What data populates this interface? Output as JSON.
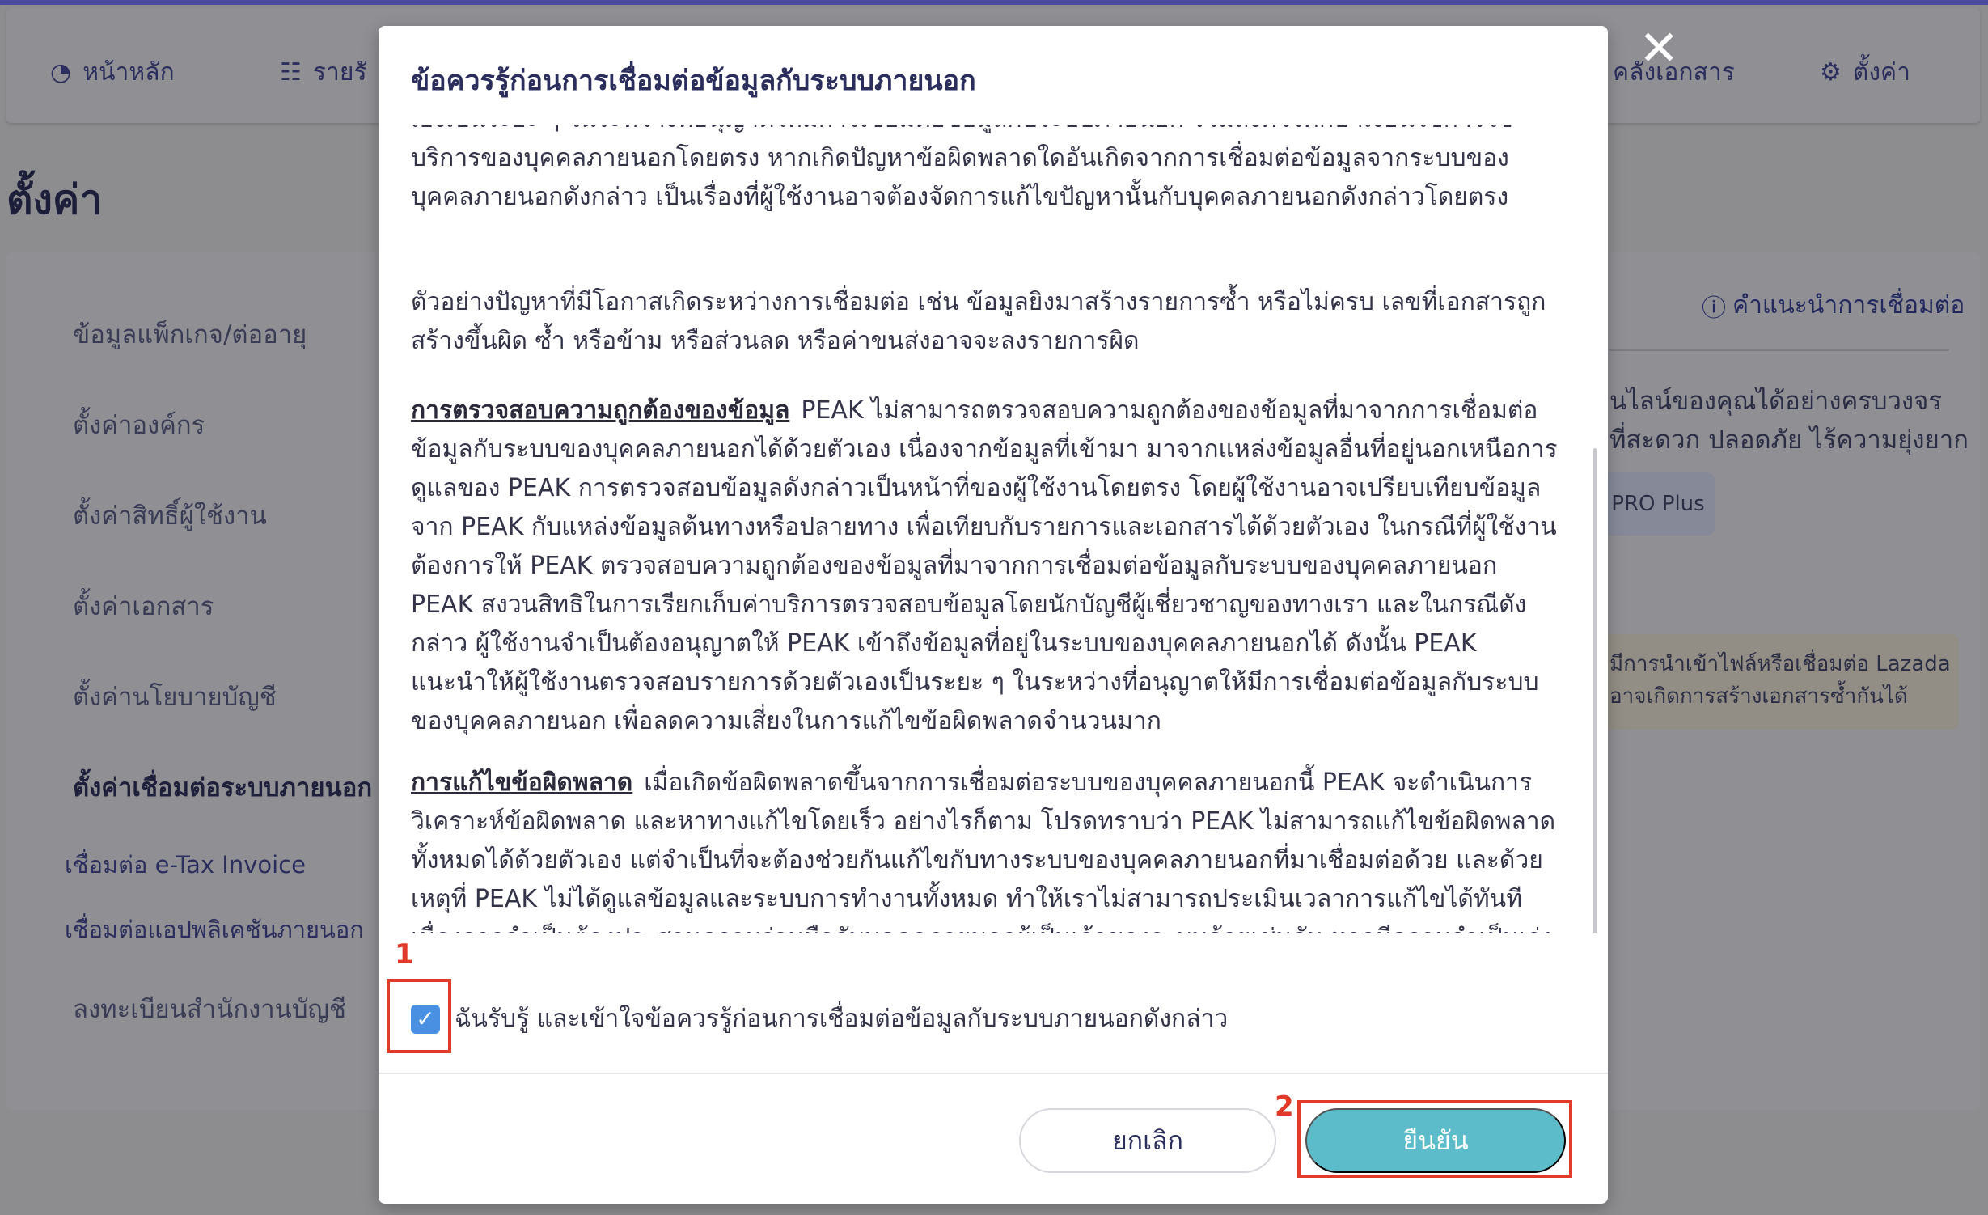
{
  "nav": {
    "home": "หน้าหลัก",
    "income": "รายรั",
    "docs": "คลังเอกสาร",
    "settings": "ตั้งค่า"
  },
  "page": {
    "title": "ตั้งค่า"
  },
  "sidebar": {
    "items": [
      "ข้อมูลแพ็กเกจ/ต่ออายุ",
      "ตั้งค่าองค์กร",
      "ตั้งค่าสิทธิ์ผู้ใช้งาน",
      "ตั้งค่าเอกสาร",
      "ตั้งค่านโยบายบัญชี",
      "ตั้งค่าเชื่อมต่อระบบภายนอก"
    ],
    "subitems": [
      "เชื่อมต่อ e-Tax Invoice",
      "เชื่อมต่อแอปพลิเคชันภายนอก",
      "ลงทะเบียนสำนักงานบัญชี"
    ]
  },
  "right_panel": {
    "guide_link": "คำแนะนำการเชื่อมต่อ",
    "line1": "นไลน์ของคุณได้อย่างครบวงจร",
    "line2": "ที่สะดวก ปลอดภัย ไร้ความยุ่งยาก",
    "badge": "PRO Plus",
    "warn1": "มีการนำเข้าไฟล์หรือเชื่อมต่อ Lazada",
    "warn2": "อาจเกิดการสร้างเอกสารซ้ำกันได้"
  },
  "modal": {
    "title": "ข้อควรรู้ก่อนการเชื่อมต่อข้อมูลกับระบบภายนอก",
    "para0": "เองเป็นระยะ ๆ ในระหว่างที่อนุญาตให้มีการเชื่อมต่อข้อมูลกับระบบภายนอก รวมถึงควรศึกษาเงื่อนไขการใช้บริการของบุคคลภายนอกโดยตรง หากเกิดปัญหาข้อผิดพลาดใดอันเกิดจากการเชื่อมต่อข้อมูลจากระบบของบุคคลภายนอกดังกล่าว เป็นเรื่องที่ผู้ใช้งานอาจต้องจัดการแก้ไขปัญหานั้นกับบุคคลภายนอกดังกล่าวโดยตรง",
    "para1": "ตัวอย่างปัญหาที่มีโอกาสเกิดระหว่างการเชื่อมต่อ เช่น ข้อมูลยิงมาสร้างรายการซ้ำ หรือไม่ครบ เลขที่เอกสารถูกสร้างขึ้นผิด ซ้ำ หรือข้าม หรือส่วนลด หรือค่าขนส่งอาจจะลงรายการผิด",
    "para2_head": "การตรวจสอบความถูกต้องของข้อมูล",
    "para2_body": "PEAK ไม่สามารถตรวจสอบความถูกต้องของข้อมูลที่มาจากการเชื่อมต่อข้อมูลกับระบบของบุคคลภายนอกได้ด้วยตัวเอง เนื่องจากข้อมูลที่เข้ามา มาจากแหล่งข้อมูลอื่นที่อยู่นอกเหนือการดูแลของ PEAK การตรวจสอบข้อมูลดังกล่าวเป็นหน้าที่ของผู้ใช้งานโดยตรง โดยผู้ใช้งานอาจเปรียบเทียบข้อมูลจาก PEAK กับแหล่งข้อมูลต้นทางหรือปลายทาง เพื่อเทียบกับรายการและเอกสารได้ด้วยตัวเอง ในกรณีที่ผู้ใช้งานต้องการให้ PEAK ตรวจสอบความถูกต้องของข้อมูลที่มาจากการเชื่อมต่อข้อมูลกับระบบของบุคคลภายนอก PEAK สงวนสิทธิในการเรียกเก็บค่าบริการตรวจสอบข้อมูลโดยนักบัญชีผู้เชี่ยวชาญของทางเรา และในกรณีดังกล่าว ผู้ใช้งานจำเป็นต้องอนุญาตให้ PEAK เข้าถึงข้อมูลที่อยู่ในระบบของบุคคลภายนอกได้ ดังนั้น PEAK แนะนำให้ผู้ใช้งานตรวจสอบรายการด้วยตัวเองเป็นระยะ ๆ ในระหว่างที่อนุญาตให้มีการเชื่อมต่อข้อมูลกับระบบของบุคคลภายนอก เพื่อลดความเสี่ยงในการแก้ไขข้อผิดพลาดจำนวนมาก",
    "para3_head": "การแก้ไขข้อผิดพลาด",
    "para3_body": "เมื่อเกิดข้อผิดพลาดขึ้นจากการเชื่อมต่อระบบของบุคคลภายนอกนี้ PEAK จะดำเนินการวิเคราะห์ข้อผิดพลาด และหาทางแก้ไขโดยเร็ว อย่างไรก็ตาม โปรดทราบว่า PEAK ไม่สามารถแก้ไขข้อผิดพลาดทั้งหมดได้ด้วยตัวเอง แต่จำเป็นที่จะต้องช่วยกันแก้ไขกับทางระบบของบุคคลภายนอกที่มาเชื่อมต่อด้วย และด้วยเหตุที่ PEAK ไม่ได้ดูแลข้อมูลและระบบการทำงานทั้งหมด ทำให้เราไม่สามารถประเมินเวลาการแก้ไขได้ทันที เนื่องจากจำเป็นต้องประสานความร่วมมือกับบุคคลภายนอกผู้เป็นเจ้าของระบบด้วยเช่นกัน หากมีความจำเป็นเร่งด่วนในการใช้ข้อมูล PEAK แนะนำให้ทำการแก้ปัญหาเฉพาะหน้าตามคำแนะนำของทีมงานของเราก่อน",
    "checkbox_label": "ฉันรับรู้ และเข้าใจข้อควรรู้ก่อนการเชื่อมต่อข้อมูลกับระบบภายนอกดังกล่าว",
    "checkbox_checked": true,
    "cancel": "ยกเลิก",
    "confirm": "ยืนยัน"
  },
  "annotations": {
    "step1": "1",
    "step2": "2"
  },
  "colors": {
    "confirm": "#5cbcc9",
    "annotation": "#e23a2a",
    "checkbox": "#4a90e2"
  }
}
